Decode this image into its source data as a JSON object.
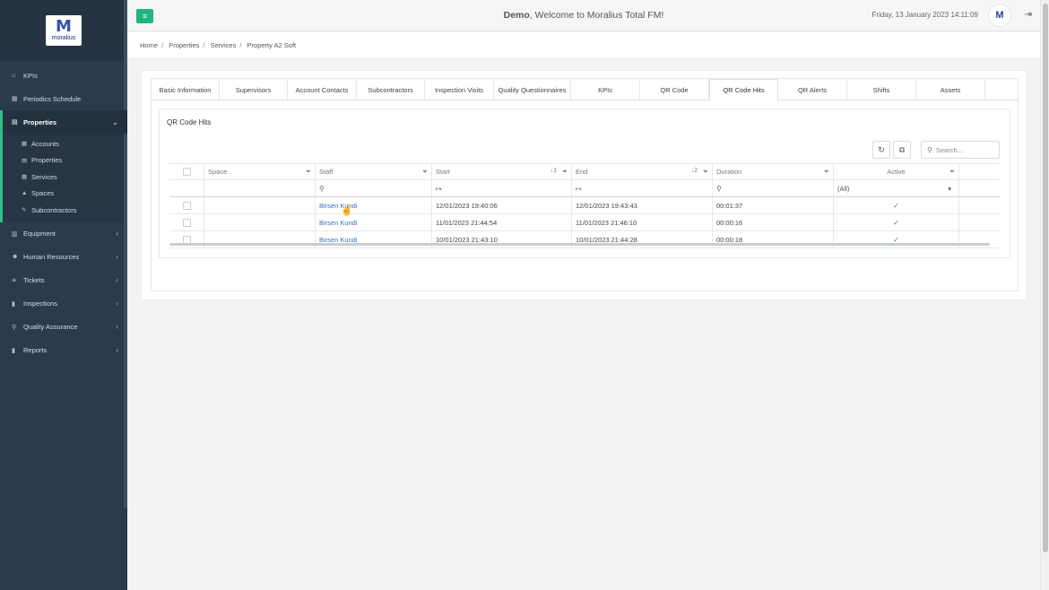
{
  "app": {
    "logo_text": "moralius",
    "welcome_bold": "Demo",
    "welcome_text": ", Welcome to Moralius Total FM!",
    "datetime": "Friday, 13 January 2023 14:11:09"
  },
  "sidebar": {
    "items": [
      {
        "label": "KPIs",
        "icon": "home-icon"
      },
      {
        "label": "Periodics Schedule",
        "icon": "calendar-icon"
      },
      {
        "label": "Properties",
        "icon": "building-icon"
      },
      {
        "label": "Equipment",
        "icon": "box-icon"
      },
      {
        "label": "Human Resources",
        "icon": "users-icon"
      },
      {
        "label": "Tickets",
        "icon": "ticket-icon"
      },
      {
        "label": "Inspections",
        "icon": "book-icon"
      },
      {
        "label": "Quality Assurance",
        "icon": "search-icon"
      },
      {
        "label": "Reports",
        "icon": "book-icon"
      }
    ],
    "sub_items": [
      {
        "label": "Accounts"
      },
      {
        "label": "Properties"
      },
      {
        "label": "Services"
      },
      {
        "label": "Spaces"
      },
      {
        "label": "Subcontractors"
      }
    ]
  },
  "breadcrumb": [
    "Home",
    "Properties",
    "Services",
    "Property A2 Soft"
  ],
  "tabs": [
    "Basic Information",
    "Supervisors",
    "Account Contacts",
    "Subcontractors",
    "Inspection Visits",
    "Quality Questionnaires",
    "KPIs",
    "QR Code",
    "QR Code Hits",
    "QR Alerts",
    "Shifts",
    "Assets"
  ],
  "active_tab": "QR Code Hits",
  "card": {
    "title": "QR Code Hits",
    "search_placeholder": "Search..."
  },
  "grid": {
    "columns": [
      "Space",
      "Staff",
      "Start",
      "End",
      "Duration",
      "Active"
    ],
    "start_sort": "↓1",
    "end_sort": "↓2",
    "filter_select": "(All)",
    "date_range_glyph": "↦",
    "rows": [
      {
        "space": "",
        "staff": "Birsen Kundi",
        "start": "12/01/2023 19:40:06",
        "end": "12/01/2023 19:43:43",
        "duration": "00:01:37",
        "active": "✓"
      },
      {
        "space": "",
        "staff": "Birsen Kundi",
        "start": "11/01/2023 21:44:54",
        "end": "11/01/2023 21:46:10",
        "duration": "00:00:16",
        "active": "✓"
      },
      {
        "space": "",
        "staff": "Birsen Kundi",
        "start": "10/01/2023 21:43:10",
        "end": "10/01/2023 21:44:28",
        "duration": "00:00:18",
        "active": "✓"
      }
    ]
  },
  "colors": {
    "sidebar": "#2c3b4c",
    "accent": "#1fb57d",
    "link": "#3a6fc4"
  }
}
